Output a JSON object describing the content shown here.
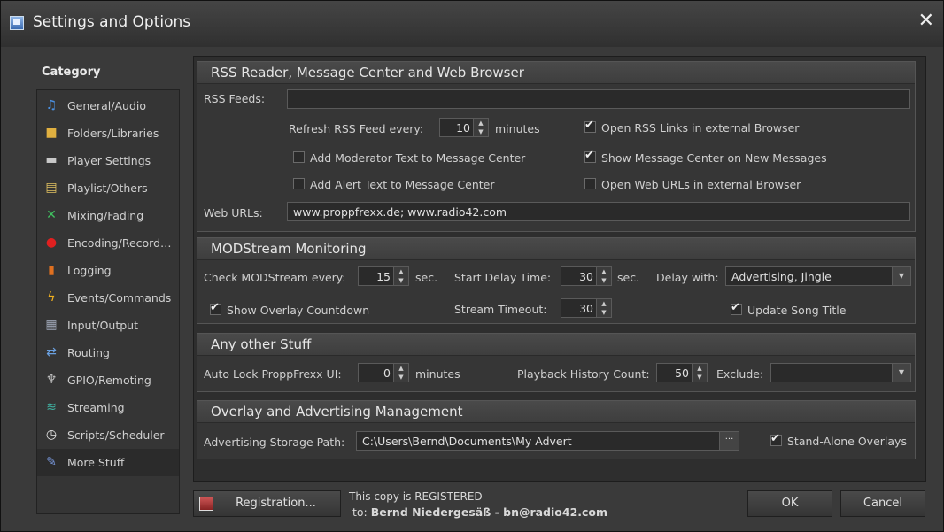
{
  "window": {
    "title": "Settings and Options",
    "close_glyph": "✕"
  },
  "category": {
    "heading": "Category",
    "items": [
      {
        "label": "General/Audio",
        "icon": "music-note-icon",
        "glyph": "♫",
        "color": "#4a8fe0"
      },
      {
        "label": "Folders/Libraries",
        "icon": "folder-icon",
        "glyph": "■",
        "color": "#e0b040"
      },
      {
        "label": "Player Settings",
        "icon": "player-icon",
        "glyph": "▬",
        "color": "#c8c8c8"
      },
      {
        "label": "Playlist/Others",
        "icon": "playlist-icon",
        "glyph": "▤",
        "color": "#e0c060"
      },
      {
        "label": "Mixing/Fading",
        "icon": "mixing-icon",
        "glyph": "✕",
        "color": "#40c060"
      },
      {
        "label": "Encoding/Record…",
        "icon": "record-icon",
        "glyph": "●",
        "color": "#e02020"
      },
      {
        "label": "Logging",
        "icon": "logging-icon",
        "glyph": "▮",
        "color": "#e07020"
      },
      {
        "label": "Events/Commands",
        "icon": "lightning-icon",
        "glyph": "ϟ",
        "color": "#f0b020"
      },
      {
        "label": "Input/Output",
        "icon": "input-output-icon",
        "glyph": "▦",
        "color": "#a0a8b8"
      },
      {
        "label": "Routing",
        "icon": "routing-icon",
        "glyph": "⇄",
        "color": "#6aa0e0"
      },
      {
        "label": "GPIO/Remoting",
        "icon": "gpio-icon",
        "glyph": "♆",
        "color": "#c0c0c0"
      },
      {
        "label": "Streaming",
        "icon": "streaming-icon",
        "glyph": "≋",
        "color": "#40b0a0"
      },
      {
        "label": "Scripts/Scheduler",
        "icon": "clock-icon",
        "glyph": "◷",
        "color": "#e8e8e8"
      },
      {
        "label": "More Stuff",
        "icon": "more-stuff-icon",
        "glyph": "✎",
        "color": "#7a9ae0",
        "selected": true
      }
    ]
  },
  "rss": {
    "title": "RSS Reader, Message Center and Web Browser",
    "feeds_label": "RSS Feeds:",
    "feeds_value": "",
    "refresh_label": "Refresh RSS Feed every:",
    "refresh_value": "10",
    "refresh_unit": "minutes",
    "open_links_label": "Open RSS Links in external Browser",
    "open_links_checked": true,
    "add_moderator_label": "Add Moderator Text to Message Center",
    "add_moderator_checked": false,
    "show_message_label": "Show Message Center on New Messages",
    "show_message_checked": true,
    "add_alert_label": "Add Alert Text to Message Center",
    "add_alert_checked": false,
    "open_web_label": "Open Web URLs in external Browser",
    "open_web_checked": false,
    "web_urls_label": "Web URLs:",
    "web_urls_value": "www.proppfrexx.de; www.radio42.com"
  },
  "modstream": {
    "title": "MODStream Monitoring",
    "check_label": "Check MODStream every:",
    "check_value": "15",
    "check_unit": "sec.",
    "start_delay_label": "Start Delay Time:",
    "start_delay_value": "30",
    "start_delay_unit": "sec.",
    "delay_with_label": "Delay with:",
    "delay_with_value": "Advertising, Jingle",
    "show_overlay_label": "Show Overlay Countdown",
    "show_overlay_checked": true,
    "stream_timeout_label": "Stream Timeout:",
    "stream_timeout_value": "30",
    "update_song_label": "Update Song Title",
    "update_song_checked": true
  },
  "other": {
    "title": "Any other Stuff",
    "auto_lock_label": "Auto Lock ProppFrexx UI:",
    "auto_lock_value": "0",
    "auto_lock_unit": "minutes",
    "history_label": "Playback History Count:",
    "history_value": "50",
    "exclude_label": "Exclude:",
    "exclude_value": ""
  },
  "overlay": {
    "title": "Overlay and Advertising Management",
    "path_label": "Advertising Storage Path:",
    "path_value": "C:\\Users\\Bernd\\Documents\\My Advert",
    "browse_label": "···",
    "standalone_label": "Stand-Alone Overlays",
    "standalone_checked": true
  },
  "footer": {
    "registration_label": "Registration...",
    "registered_line1": "This copy is REGISTERED",
    "registered_to_prefix": "to:",
    "registered_to": "Bernd Niedergesäß - bn@radio42.com",
    "ok_label": "OK",
    "cancel_label": "Cancel"
  },
  "colors": {
    "background": "#3a3a3a",
    "panel": "#363636",
    "text": "#d0d0d0"
  }
}
